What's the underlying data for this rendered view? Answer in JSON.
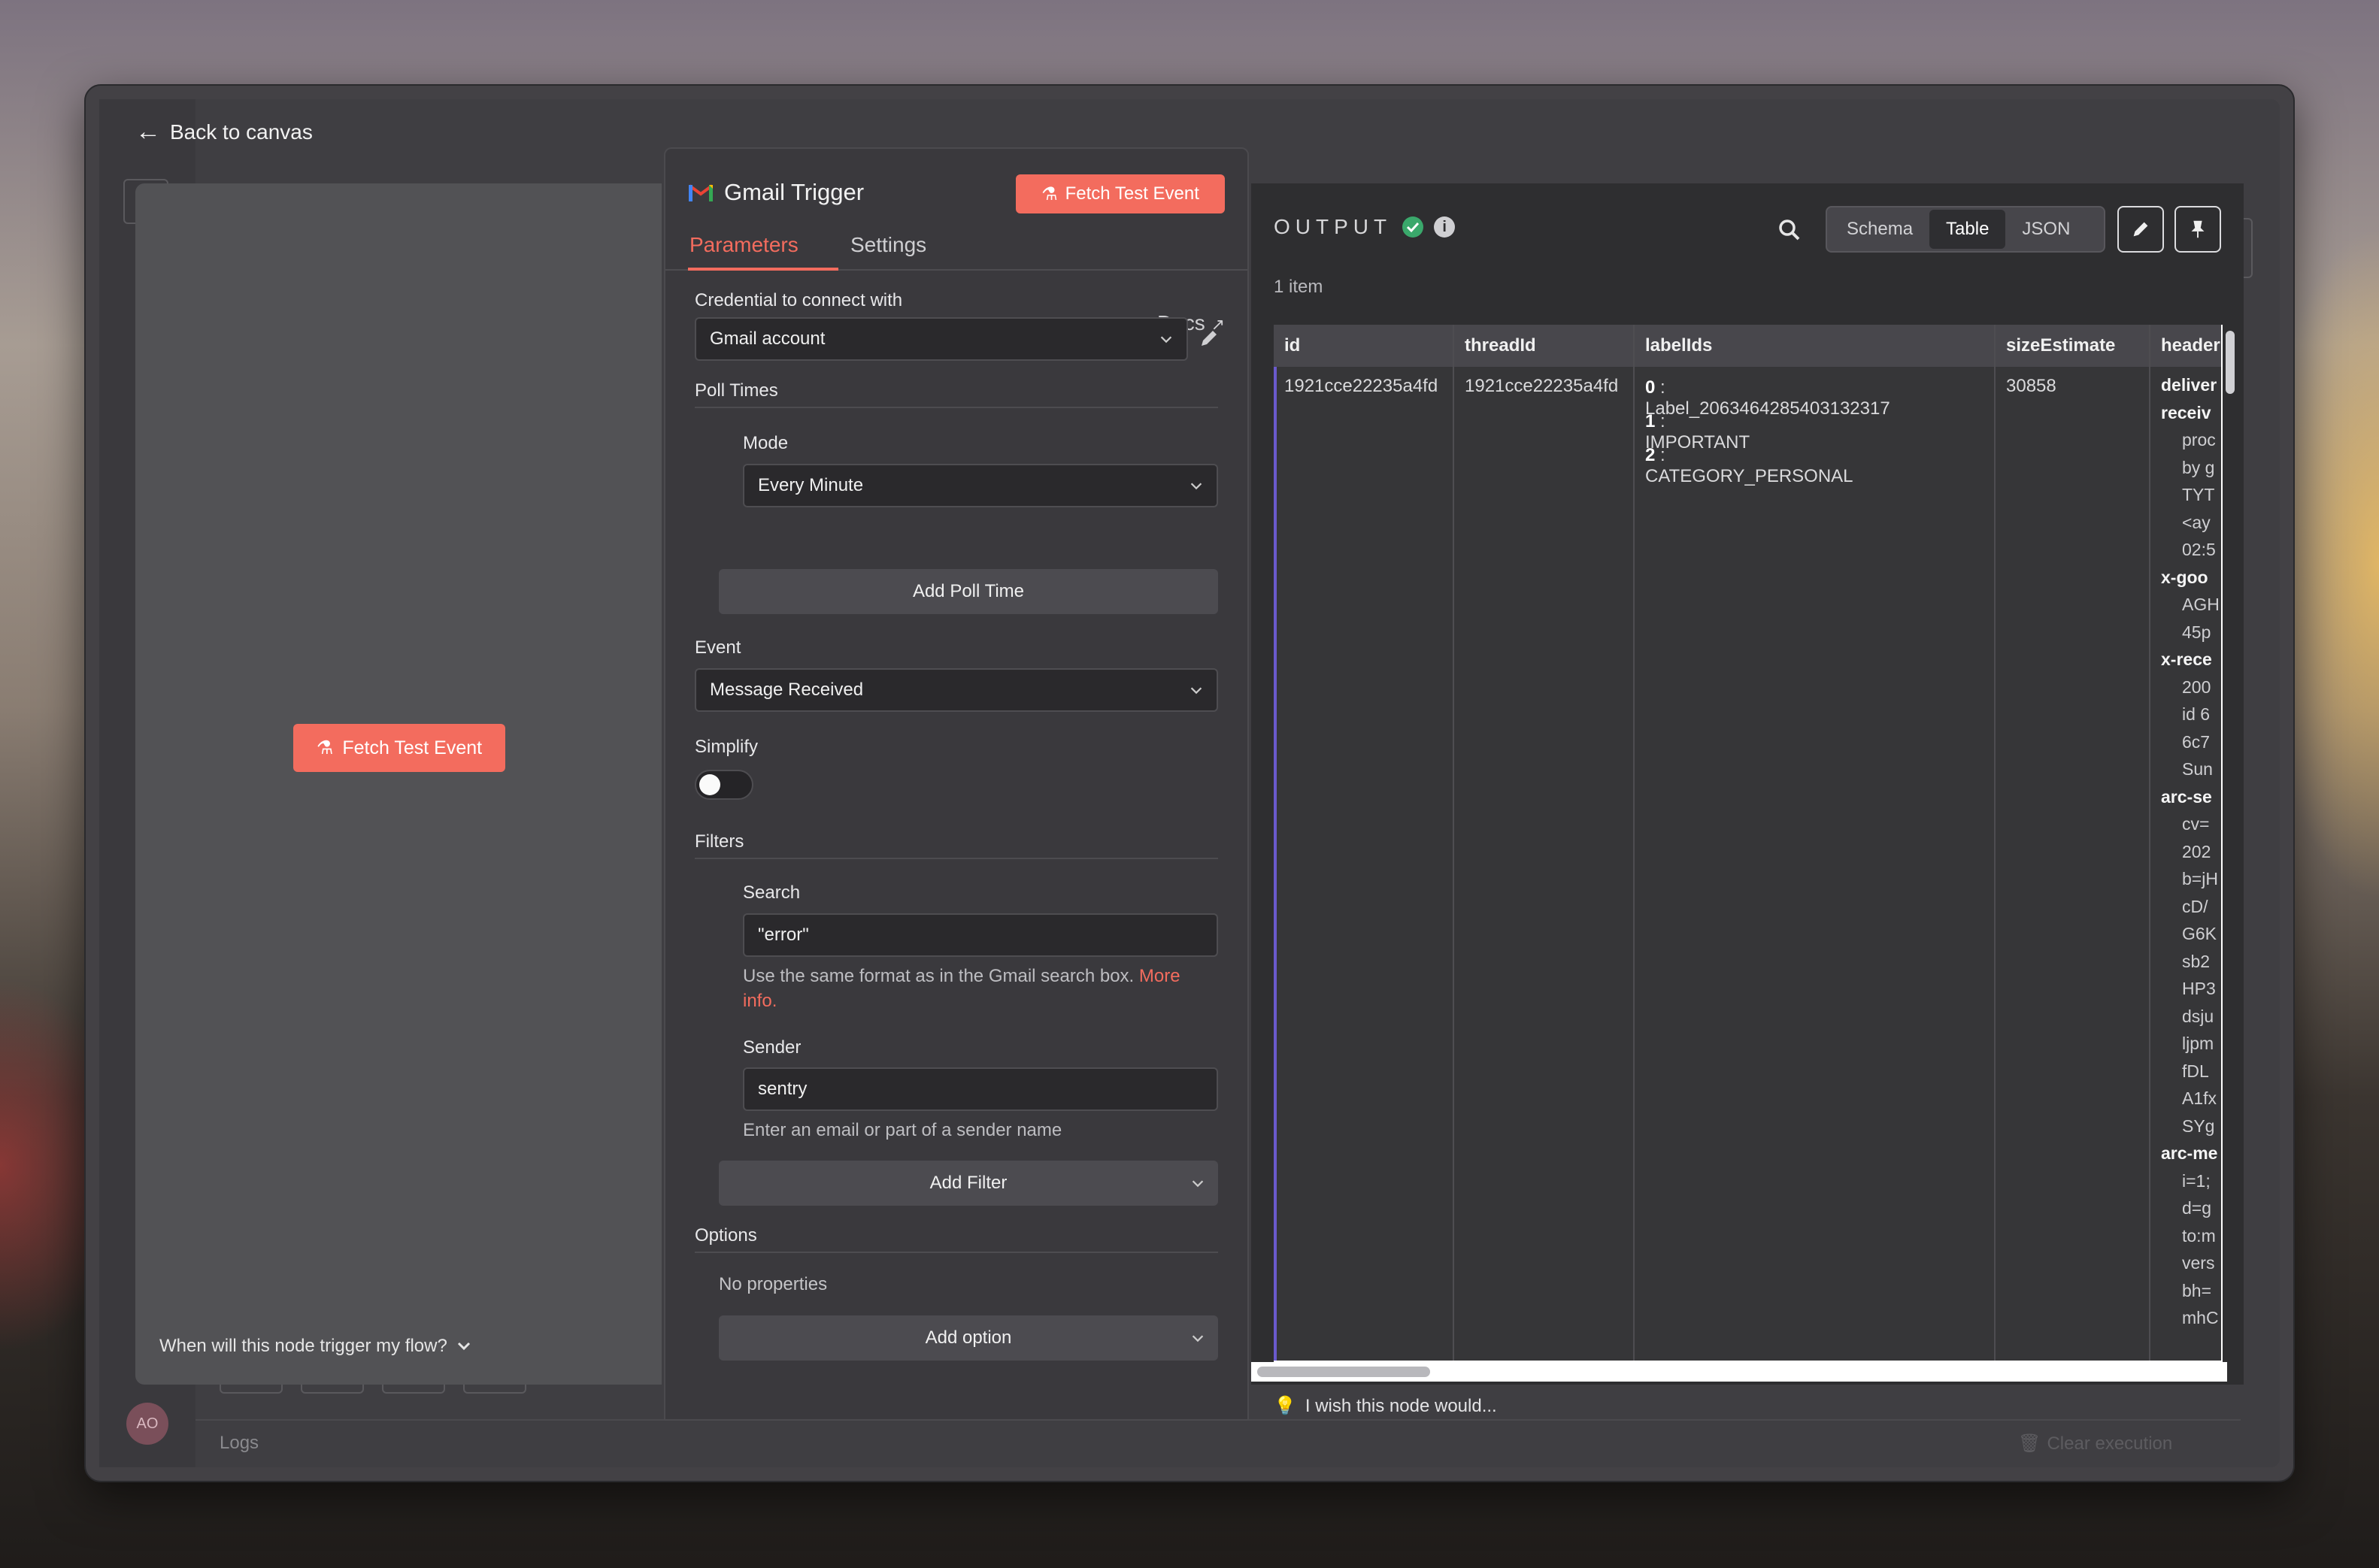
{
  "nav": {
    "back_label": "Back to canvas"
  },
  "user": {
    "initials": "AO"
  },
  "logs": {
    "label": "Logs",
    "clear_label": "Clear execution"
  },
  "canvas": {
    "fetch_label": "Fetch Test Event",
    "trigger_question": "When will this node trigger my flow?"
  },
  "node": {
    "title": "Gmail Trigger",
    "fetch_label": "Fetch Test Event",
    "tabs": [
      {
        "label": "Parameters"
      },
      {
        "label": "Settings"
      }
    ],
    "docs_label": "Docs"
  },
  "params": {
    "credential_label": "Credential to connect with",
    "credential_value": "Gmail account",
    "poll_times_label": "Poll Times",
    "mode_label": "Mode",
    "mode_value": "Every Minute",
    "add_poll_label": "Add Poll Time",
    "event_label": "Event",
    "event_value": "Message Received",
    "simplify_label": "Simplify",
    "filters_label": "Filters",
    "search_label": "Search",
    "search_value": "\"error\"",
    "search_hint": "Use the same format as in the Gmail search box.",
    "search_hint_link": "More info",
    "sender_label": "Sender",
    "sender_value": "sentry",
    "sender_hint": "Enter an email or part of a sender name",
    "add_filter_label": "Add Filter",
    "options_label": "Options",
    "no_props": "No properties",
    "add_option_label": "Add option"
  },
  "output": {
    "title": "OUTPUT",
    "item_count": "1 item",
    "views": [
      {
        "label": "Schema"
      },
      {
        "label": "Table"
      },
      {
        "label": "JSON"
      }
    ],
    "columns": [
      "id",
      "threadId",
      "labelIds",
      "sizeEstimate",
      "header"
    ],
    "row": {
      "id": "1921cce22235a4fd",
      "threadId": "1921cce22235a4fd",
      "labels": [
        {
          "i": "0",
          "v": "Label_2063464285403132317"
        },
        {
          "i": "1",
          "v": "IMPORTANT"
        },
        {
          "i": "2",
          "v": "CATEGORY_PERSONAL"
        }
      ],
      "sizeEstimate": "30858",
      "headers": [
        {
          "k": true,
          "t": "deliver"
        },
        {
          "k": true,
          "t": "receiv"
        },
        {
          "k": false,
          "t": "proc"
        },
        {
          "k": false,
          "t": "by g"
        },
        {
          "k": false,
          "t": "TYT"
        },
        {
          "k": false,
          "t": "<ay"
        },
        {
          "k": false,
          "t": "02:5"
        },
        {
          "k": true,
          "t": "x-goo"
        },
        {
          "k": false,
          "t": "AGH"
        },
        {
          "k": false,
          "t": "45p"
        },
        {
          "k": true,
          "t": "x-rece"
        },
        {
          "k": false,
          "t": "200"
        },
        {
          "k": false,
          "t": "id 6"
        },
        {
          "k": false,
          "t": "6c7"
        },
        {
          "k": false,
          "t": "Sun"
        },
        {
          "k": true,
          "t": "arc-se"
        },
        {
          "k": false,
          "t": "cv="
        },
        {
          "k": false,
          "t": "202"
        },
        {
          "k": false,
          "t": "b=jH"
        },
        {
          "k": false,
          "t": "cD/"
        },
        {
          "k": false,
          "t": "G6K"
        },
        {
          "k": false,
          "t": "sb2"
        },
        {
          "k": false,
          "t": "HP3"
        },
        {
          "k": false,
          "t": "dsju"
        },
        {
          "k": false,
          "t": "ljpm"
        },
        {
          "k": false,
          "t": "fDL"
        },
        {
          "k": false,
          "t": "A1fx"
        },
        {
          "k": false,
          "t": "SYg"
        },
        {
          "k": true,
          "t": "arc-me"
        },
        {
          "k": false,
          "t": "i=1;"
        },
        {
          "k": false,
          "t": "d=g"
        },
        {
          "k": false,
          "t": "to:m"
        },
        {
          "k": false,
          "t": "vers"
        },
        {
          "k": false,
          "t": "bh="
        },
        {
          "k": false,
          "t": "mhC"
        }
      ]
    },
    "wish_label": "I wish this node would..."
  },
  "colors": {
    "accent": "#f36c5e",
    "success": "#3aa86b"
  }
}
